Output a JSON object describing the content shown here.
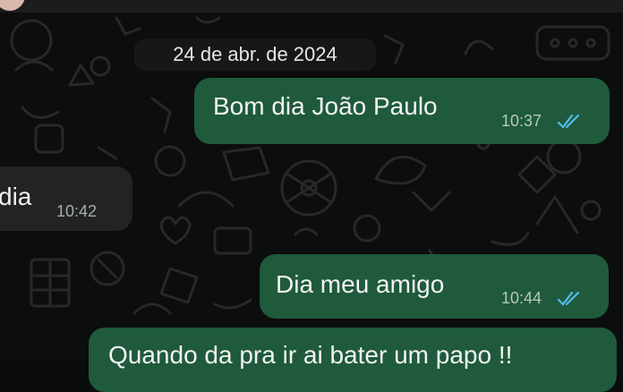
{
  "chat": {
    "date_separator": "24 de abr. de 2024",
    "messages": [
      {
        "direction": "outgoing",
        "text": "Bom dia João Paulo",
        "time": "10:37",
        "status": "read"
      },
      {
        "direction": "incoming",
        "text": "dia",
        "time": "10:42"
      },
      {
        "direction": "outgoing",
        "text": "Dia meu amigo",
        "time": "10:44",
        "status": "read"
      },
      {
        "direction": "outgoing",
        "text": "Quando da pra ir ai bater um papo !!"
      }
    ]
  },
  "colors": {
    "background": "#0c0d0d",
    "outgoing_bubble": "#1f5a3d",
    "incoming_bubble": "#222424",
    "read_ticks": "#53bdeb"
  }
}
